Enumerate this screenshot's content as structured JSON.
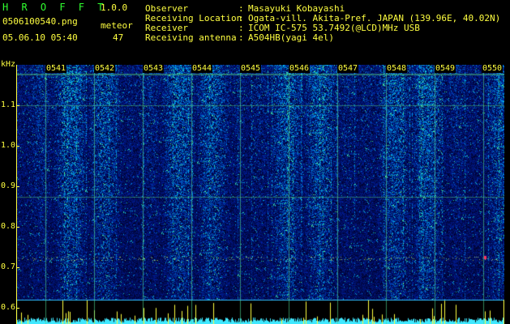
{
  "header": {
    "app_name": "H R O F F T",
    "version": "1.0.0",
    "filename": "0506100540.png",
    "mode": "meteor",
    "datetime": "05.06.10 05:40",
    "count": "47"
  },
  "station": {
    "labels": [
      "Observer",
      "Receiving Location",
      "Receiver",
      "Receiving antenna"
    ],
    "separator": ":",
    "values": [
      "Masayuki Kobayashi",
      "Ogata-vill. Akita-Pref. JAPAN (139.96E, 40.02N)",
      "ICOM IC-575 53.7492(@LCD)MHz USB",
      "A504HB(yagi 4el)"
    ]
  },
  "axes": {
    "y_unit": "kHz",
    "y_ticks": [
      "1.1",
      "1.0",
      "0.9",
      "0.8",
      "0.7",
      "0.6"
    ],
    "time_marks": [
      "0541",
      "0542",
      "0543",
      "0544",
      "0545",
      "0546",
      "0547",
      "0548",
      "0549",
      "0550"
    ]
  },
  "colors": {
    "text_green": "#30ff30",
    "text_yellow": "#ffff40",
    "spectrogram_low": "#001060",
    "spectrogram_high": "#40ffb0",
    "signal_cyan": "#40e8ff"
  }
}
